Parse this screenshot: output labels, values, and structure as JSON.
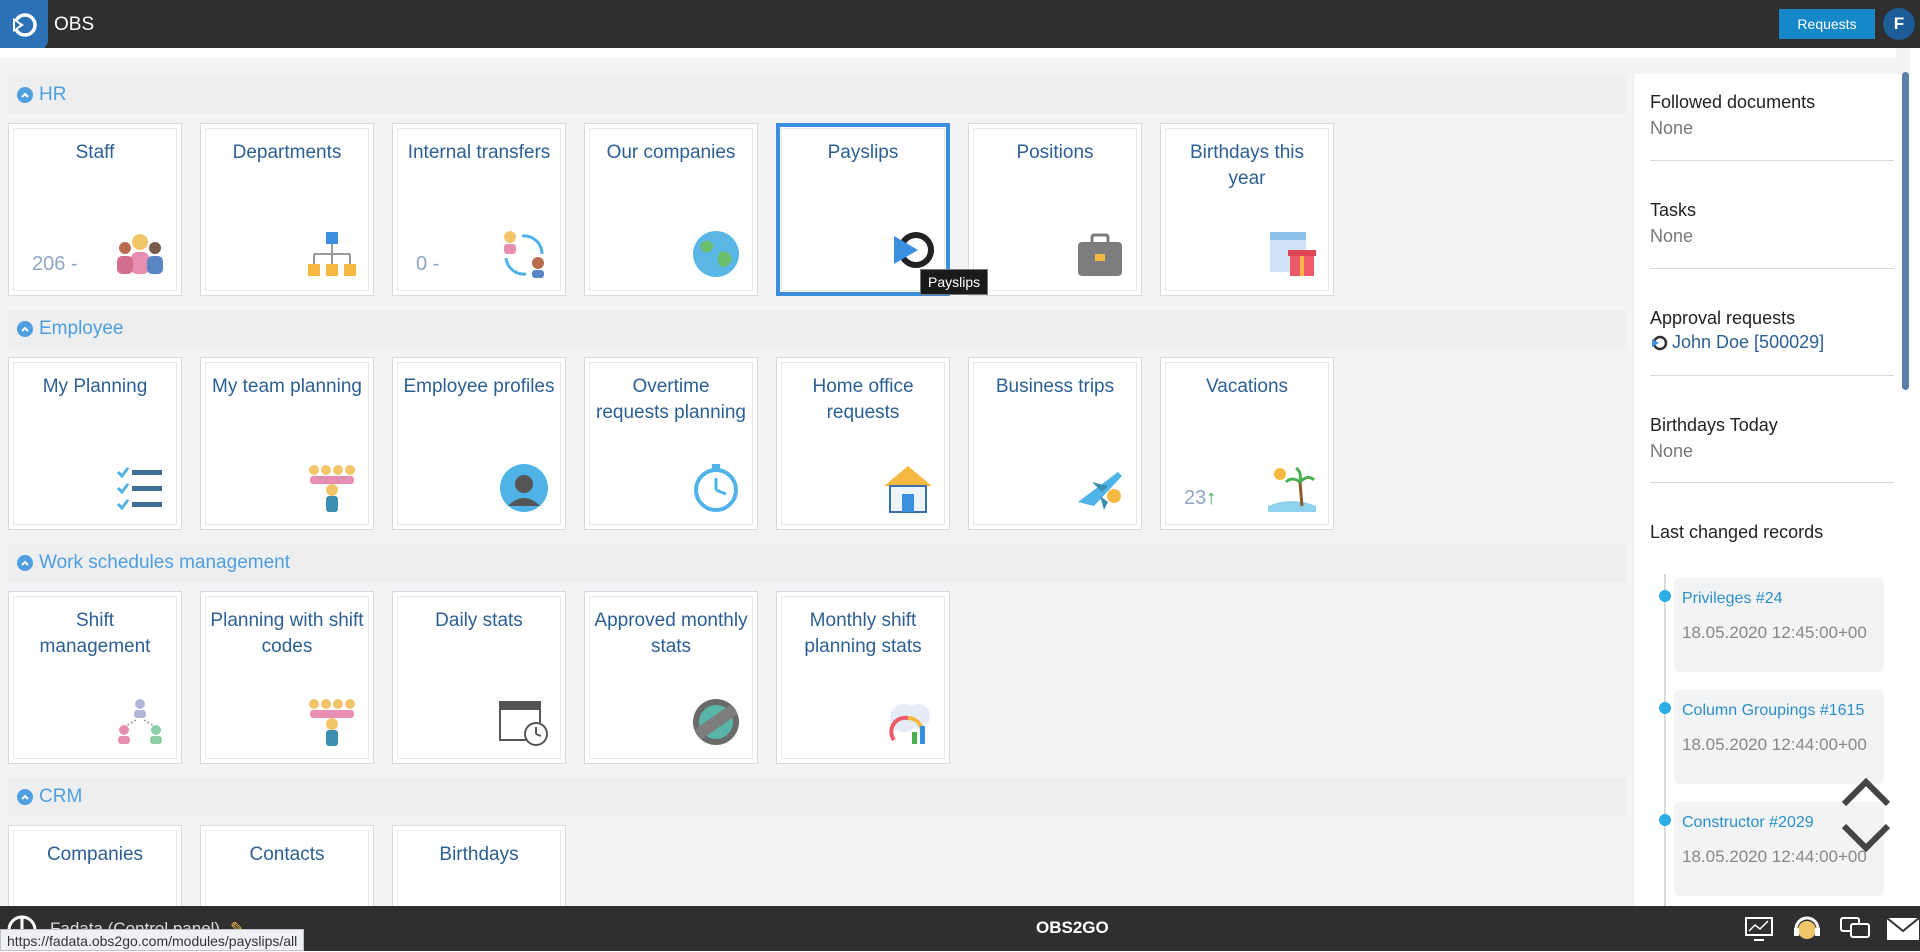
{
  "header": {
    "app_title": "OBS",
    "requests_button": "Requests",
    "user_initial": "F"
  },
  "sections": {
    "hr": {
      "title": "HR",
      "tiles": {
        "staff": {
          "label": "Staff",
          "count": "206 -"
        },
        "departments": {
          "label": "Departments"
        },
        "internal_transfers": {
          "label": "Internal transfers",
          "count": "0 -"
        },
        "our_companies": {
          "label": "Our companies"
        },
        "payslips": {
          "label": "Payslips"
        },
        "positions": {
          "label": "Positions"
        },
        "birthdays_year": {
          "label": "Birthdays this year"
        }
      }
    },
    "employee": {
      "title": "Employee",
      "tiles": {
        "my_planning": {
          "label": "My Planning"
        },
        "my_team_planning": {
          "label": "My team planning"
        },
        "employee_profiles": {
          "label": "Employee profiles"
        },
        "overtime_requests": {
          "label": "Overtime requests planning"
        },
        "home_office": {
          "label": "Home office requests"
        },
        "business_trips": {
          "label": "Business trips"
        },
        "vacations": {
          "label": "Vacations",
          "count": "23"
        }
      }
    },
    "work_schedules": {
      "title": "Work schedules management",
      "tiles": {
        "shift_management": {
          "label": "Shift management"
        },
        "planning_shift_codes": {
          "label": "Planning with shift codes"
        },
        "daily_stats": {
          "label": "Daily stats"
        },
        "approved_monthly": {
          "label": "Approved monthly stats"
        },
        "monthly_shift": {
          "label": "Monthly shift planning stats"
        }
      }
    },
    "crm": {
      "title": "CRM",
      "tiles": {
        "companies": {
          "label": "Companies"
        },
        "contacts": {
          "label": "Contacts"
        },
        "birthdays": {
          "label": "Birthdays"
        }
      }
    }
  },
  "tooltip": "Payslips",
  "right_panel": {
    "followed_documents": {
      "title": "Followed documents",
      "value": "None"
    },
    "tasks": {
      "title": "Tasks",
      "value": "None"
    },
    "approval_requests": {
      "title": "Approval requests",
      "link": "John Doe [500029]"
    },
    "birthdays_today": {
      "title": "Birthdays Today",
      "value": "None"
    },
    "last_changed": {
      "title": "Last changed records",
      "items": [
        {
          "name": "Privileges #24",
          "time": "18.05.2020 12:45:00+00"
        },
        {
          "name": "Column Groupings #1615",
          "time": "18.05.2020 12:44:00+00"
        },
        {
          "name": "Constructor #2029",
          "time": "18.05.2020 12:44:00+00"
        }
      ]
    }
  },
  "footer": {
    "title": "OBS2GO",
    "left_label": "Fadata (Control panel)",
    "status_url": "https://fadata.obs2go.com/modules/payslips/all"
  },
  "colors": {
    "accent": "#4f9fe0",
    "topbar": "#2f2f2f",
    "requests_button": "#1687c7",
    "tile_label": "#2c5f94",
    "timeline_dot": "#2eaee6"
  }
}
